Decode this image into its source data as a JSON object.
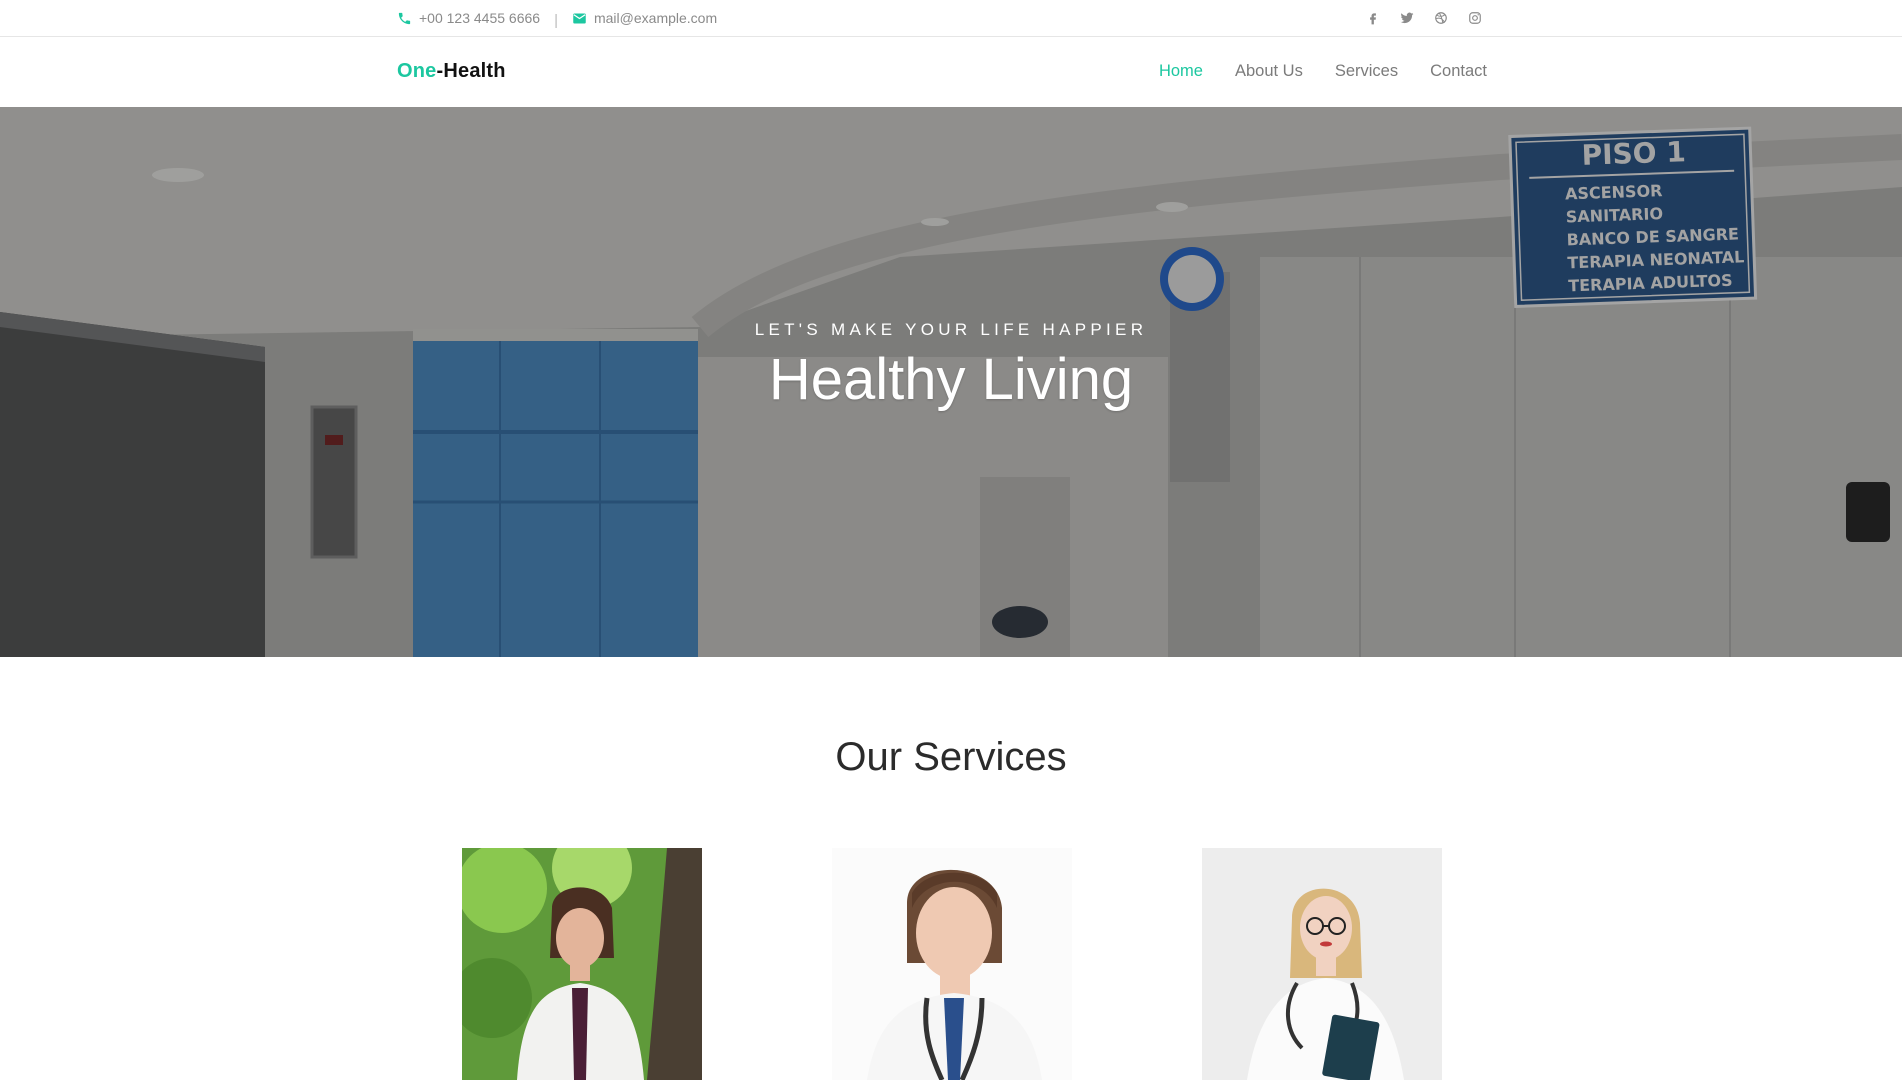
{
  "topbar": {
    "phone": "+00 123 4455 6666",
    "separator": "|",
    "email": "mail@example.com",
    "social_icons": [
      "facebook-icon",
      "twitter-icon",
      "dribbble-icon",
      "instagram-icon"
    ]
  },
  "navbar": {
    "logo_part1": "One",
    "logo_part2": "-Health",
    "menu": [
      {
        "label": "Home",
        "active": true
      },
      {
        "label": "About Us",
        "active": false
      },
      {
        "label": "Services",
        "active": false
      },
      {
        "label": "Contact",
        "active": false
      }
    ]
  },
  "hero": {
    "kicker": "LET'S MAKE YOUR LIFE HAPPIER",
    "title": "Healthy Living",
    "sign": {
      "title": "PISO 1",
      "lines": [
        "ASCENSOR",
        "SANITARIO",
        "BANCO DE SANGRE",
        "TERAPIA NEONATAL",
        "TERAPIA ADULTOS"
      ]
    }
  },
  "services": {
    "title": "Our Services"
  },
  "colors": {
    "accent": "#1cc7a0",
    "text_muted": "#8a8a8a",
    "heading": "#2b2b2b"
  }
}
